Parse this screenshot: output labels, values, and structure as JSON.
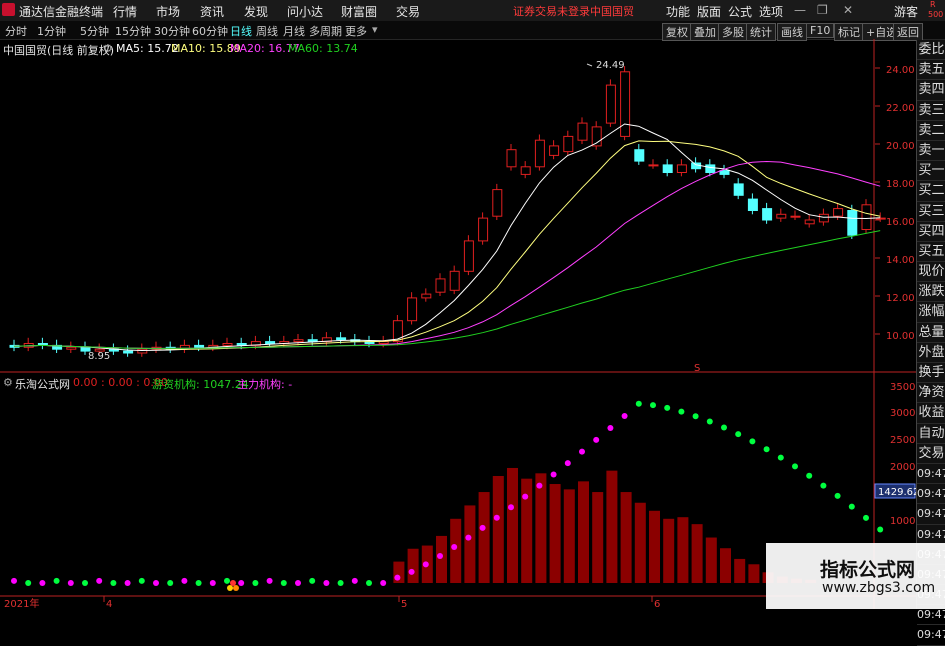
{
  "app": {
    "title": "通达信金融终端",
    "menu": [
      "行情",
      "市场",
      "资讯",
      "发现",
      "问小达",
      "财富圈",
      "交易"
    ],
    "warning": "证券交易未登录",
    "stock_name": "中国国贸",
    "right_menu": [
      "功能",
      "版面",
      "公式",
      "选项"
    ],
    "guest": "游客",
    "corner_top": "R",
    "corner_bottom": "500"
  },
  "periods": {
    "items": [
      "分时",
      "1分钟",
      "5分钟",
      "15分钟",
      "30分钟",
      "60分钟",
      "日线",
      "周线",
      "月线",
      "多周期",
      "更多"
    ],
    "active": "日线"
  },
  "toolbar": [
    "复权",
    "叠加",
    "多股",
    "统计",
    "画线",
    "F10",
    "标记",
    "+自选",
    "返回"
  ],
  "price_panel": {
    "title": "中国国贸(日线 前复权)",
    "ma5": "MA5: 15.72",
    "ma10": "MA10: 15.89",
    "ma20": "MA20: 16.77",
    "ma60": "MA60: 13.74",
    "high_label": "24.49",
    "low_label": "8.95",
    "y_ticks": [
      "24.00",
      "22.00",
      "20.00",
      "18.00",
      "16.00",
      "14.00",
      "12.00",
      "10.00"
    ],
    "marker": "S"
  },
  "indicator_panel": {
    "title": "乐淘公式网",
    "values": "0.00 : 0.00 : 0.00",
    "youzi": "游资机构: 1047.24",
    "zhuli": "主力机构: -",
    "y_ticks": [
      "3500",
      "3000",
      "2500",
      "2000",
      "1500",
      "1000"
    ],
    "cursor_value": "1429.62"
  },
  "x_axis": [
    "2021年",
    "4",
    "5",
    "6"
  ],
  "side_panel": [
    "委比",
    "卖五",
    "卖四",
    "卖三",
    "卖二",
    "卖一",
    "买一",
    "买二",
    "买三",
    "买四",
    "买五",
    "现价",
    "涨跌",
    "涨幅",
    "总量",
    "外盘",
    "换手",
    "净资",
    "收益",
    "自动",
    "交易",
    "09:47",
    "09:47",
    "09:47",
    "09:47",
    "09:47",
    "09:47",
    "09:47",
    "09:47",
    "09:47"
  ],
  "watermark": {
    "title": "指标公式网",
    "url": "www.zbgs3.com"
  },
  "colors": {
    "up": "#e02020",
    "down": "#54ffff",
    "ma5": "#ffffff",
    "ma10": "#ffff80",
    "ma20": "#ff40ff",
    "ma60": "#20d020",
    "dot_pink": "#ff00ff",
    "dot_green": "#00ff40",
    "bar": "#8b0000"
  }
}
